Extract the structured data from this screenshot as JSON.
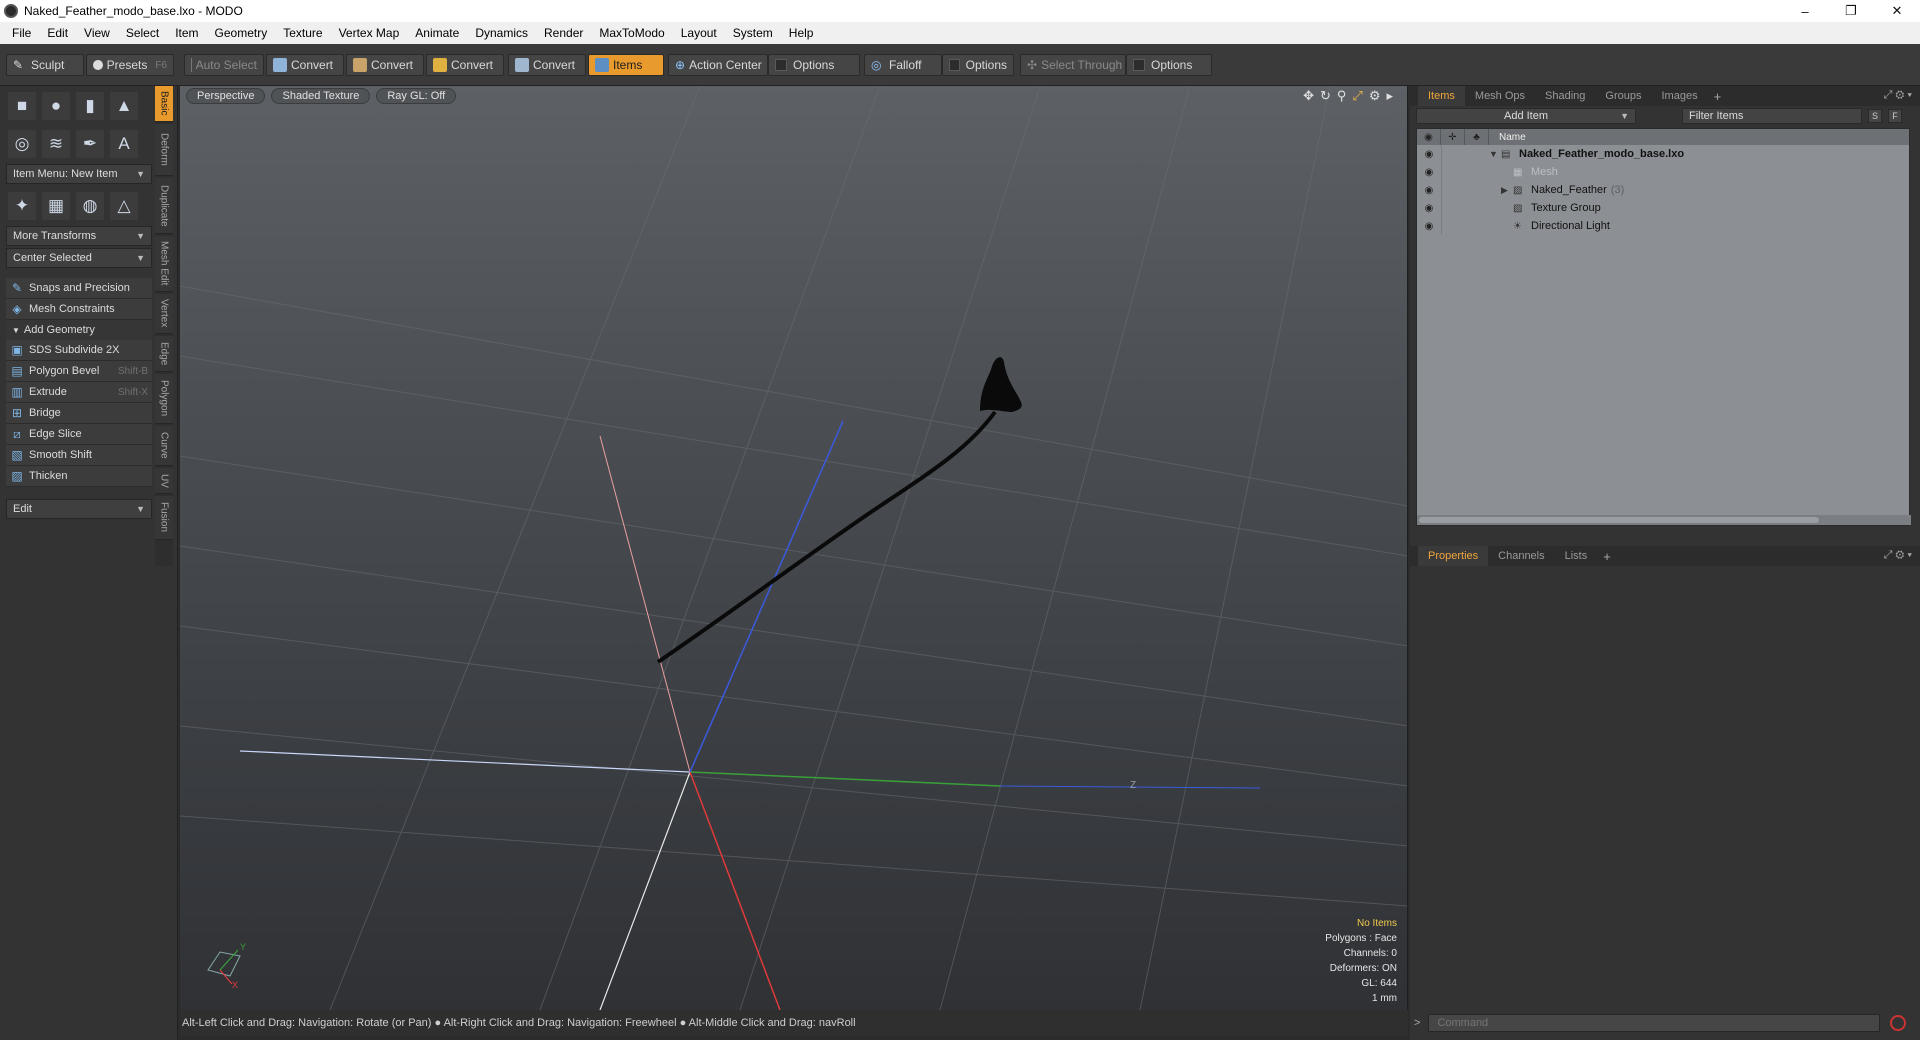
{
  "window": {
    "title": "Naked_Feather_modo_base.lxo - MODO",
    "minimize": "–",
    "maximize": "❐",
    "close": "✕"
  },
  "menubar": [
    "File",
    "Edit",
    "View",
    "Select",
    "Item",
    "Geometry",
    "Texture",
    "Vertex Map",
    "Animate",
    "Dynamics",
    "Render",
    "MaxToModo",
    "Layout",
    "System",
    "Help"
  ],
  "toolbar": {
    "sculpt": "Sculpt",
    "presets": "Presets",
    "presets_shortcut": "F6",
    "auto_select": "Auto Select",
    "convert1": "Convert",
    "convert2": "Convert",
    "convert3": "Convert",
    "convert4": "Convert",
    "items": "Items",
    "action_center": "Action Center",
    "options1": "Options",
    "falloff": "Falloff",
    "options2": "Options",
    "select_through": "Select Through",
    "options3": "Options"
  },
  "left": {
    "item_menu": "Item Menu: New Item",
    "more_transforms": "More Transforms",
    "center_selected": "Center Selected",
    "snaps": "Snaps and Precision",
    "mesh_constraints": "Mesh Constraints",
    "add_geometry": "Add Geometry",
    "tools": [
      {
        "label": "SDS Subdivide 2X",
        "shortcut": ""
      },
      {
        "label": "Polygon Bevel",
        "shortcut": "Shift-B"
      },
      {
        "label": "Extrude",
        "shortcut": "Shift-X"
      },
      {
        "label": "Bridge",
        "shortcut": ""
      },
      {
        "label": "Edge Slice",
        "shortcut": ""
      },
      {
        "label": "Smooth Shift",
        "shortcut": ""
      },
      {
        "label": "Thicken",
        "shortcut": ""
      }
    ],
    "edit": "Edit",
    "vtabs": [
      "Basic",
      "Deform",
      "Duplicate",
      "Mesh Edit",
      "Vertex",
      "Edge",
      "Polygon",
      "Curve",
      "UV",
      "Fusion"
    ]
  },
  "viewport": {
    "perspective": "Perspective",
    "shading": "Shaded Texture",
    "raygl": "Ray GL: Off",
    "info": {
      "selection": "No Items",
      "polygons": "Polygons : Face",
      "channels": "Channels: 0",
      "deformers": "Deformers: ON",
      "gl": "GL: 644",
      "unit": "1 mm"
    },
    "axis_y": "Y",
    "axis_x": "X",
    "axis_z": "Z"
  },
  "status": "Alt-Left Click and Drag: Navigation: Rotate (or Pan) ● Alt-Right Click and Drag: Navigation: Freewheel ● Alt-Middle Click and Drag: navRoll",
  "right": {
    "tabs": [
      "Items",
      "Mesh Ops",
      "Shading",
      "Groups",
      "Images"
    ],
    "add_item": "Add Item",
    "filter_items": "Filter Items",
    "s_btn": "S",
    "f_btn": "F",
    "col_name": "Name",
    "tree": {
      "scene": "Naked_Feather_modo_base.lxo",
      "mesh": "Mesh",
      "group": "Naked_Feather",
      "group_count": "(3)",
      "texture_group": "Texture Group",
      "light": "Directional Light"
    },
    "props_tabs": [
      "Properties",
      "Channels",
      "Lists"
    ],
    "command_placeholder": "Command"
  },
  "colors": {
    "accent": "#e89a2c",
    "x_axis": "#e03a3a",
    "y_axis": "#3aa03a",
    "z_axis": "#3a5ae0"
  }
}
